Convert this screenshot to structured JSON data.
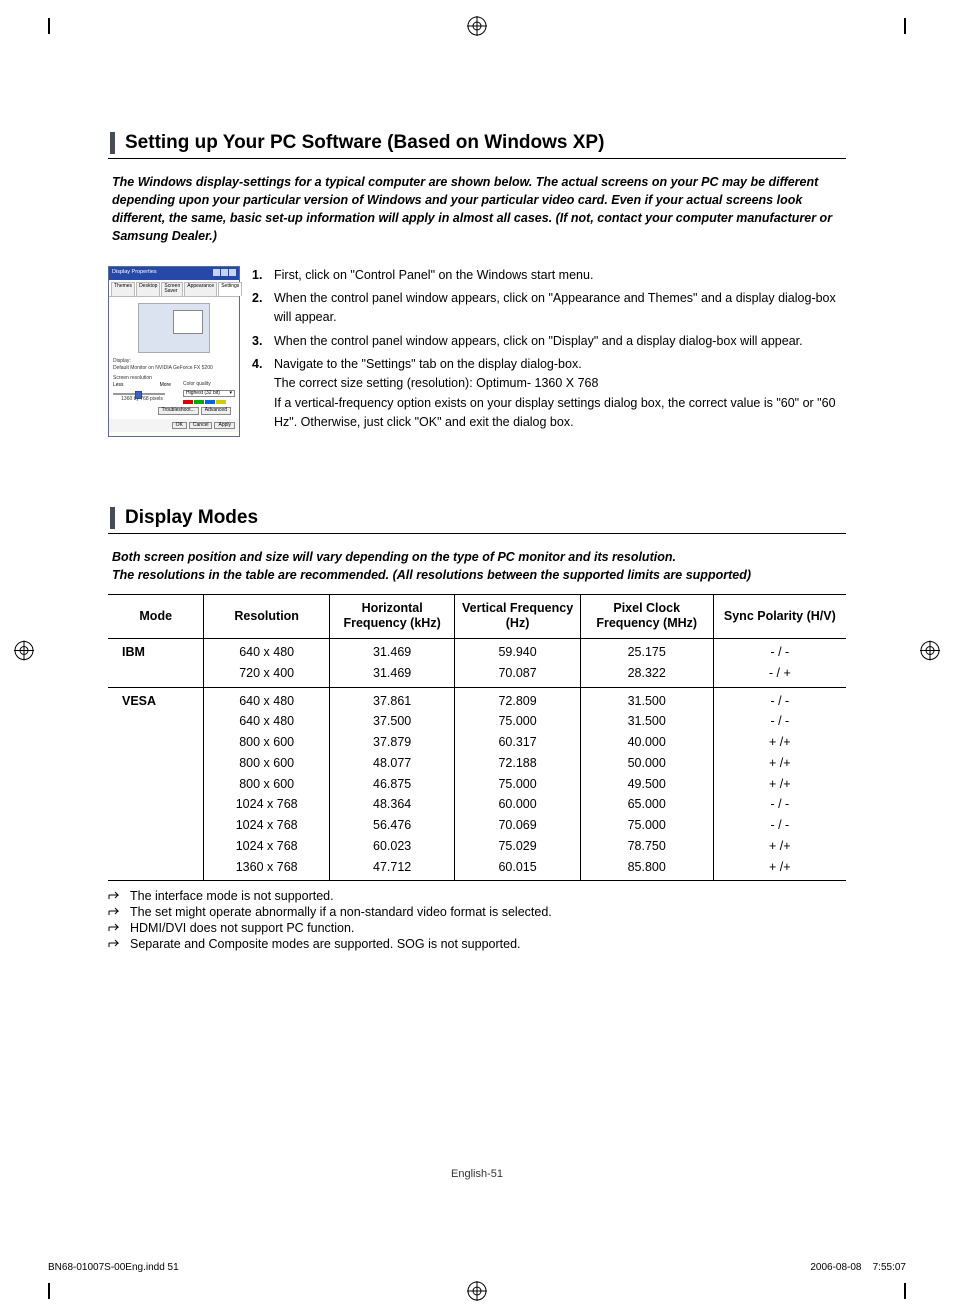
{
  "section1_title": "Setting up Your PC Software (Based on Windows XP)",
  "section1_intro": "The Windows display-settings for a typical computer are shown below. The actual screens on your PC may be different depending upon your particular version of Windows and your particular video card. Even if your actual screens look different, the same, basic set-up information will apply in almost all cases. (If not, contact your computer manufacturer or Samsung Dealer.)",
  "dialog": {
    "title": "Display Properties",
    "tabs": [
      "Themes",
      "Desktop",
      "Screen Saver",
      "Appearance",
      "Settings"
    ],
    "display_label": "Display:",
    "display_value": "Default Monitor on NVIDIA GeForce FX 5200",
    "resolution_label": "Screen resolution",
    "res_less": "Less",
    "res_more": "More",
    "res_value": "1360 by 768 pixels",
    "quality_label": "Color quality",
    "quality_value": "Highest (32 bit)",
    "troubleshoot": "Troubleshoot...",
    "advanced": "Advanced",
    "ok": "OK",
    "cancel": "Cancel",
    "apply": "Apply"
  },
  "steps": {
    "s1": "First, click on \"Control Panel\" on the Windows start menu.",
    "s2": "When the control panel window appears, click on \"Appearance and Themes\" and a display dialog-box will appear.",
    "s3": "When the control panel window appears, click on \"Display\" and a display dialog-box will appear.",
    "s4_a": "Navigate to the \"Settings\" tab on the display dialog-box.",
    "s4_b": "The correct size setting (resolution): Optimum- 1360 X 768",
    "s4_c": "If a vertical-frequency option exists on your display settings dialog box, the correct value is \"60\" or \"60 Hz\". Otherwise, just click \"OK\" and exit the dialog box."
  },
  "section2_title": "Display Modes",
  "section2_intro_a": "Both screen position and size will vary depending on the type of PC monitor and its resolution.",
  "section2_intro_b": "The resolutions in the table are recommended. (All resolutions between the supported limits are supported)",
  "table": {
    "headers": [
      "Mode",
      "Resolution",
      "Horizontal Frequency (kHz)",
      "Vertical Frequency (Hz)",
      "Pixel Clock Frequency (MHz)",
      "Sync Polarity (H/V)"
    ],
    "rows": [
      {
        "mode": "IBM",
        "res": "640 x 480",
        "hf": "31.469",
        "vf": "59.940",
        "pc": "25.175",
        "sp": "- / -",
        "first": true
      },
      {
        "mode": "",
        "res": "720 x 400",
        "hf": "31.469",
        "vf": "70.087",
        "pc": "28.322",
        "sp": "- / +",
        "last": true
      },
      {
        "mode": "VESA",
        "res": "640 x 480",
        "hf": "37.861",
        "vf": "72.809",
        "pc": "31.500",
        "sp": "- / -",
        "first": true
      },
      {
        "mode": "",
        "res": "640 x 480",
        "hf": "37.500",
        "vf": "75.000",
        "pc": "31.500",
        "sp": "- / -"
      },
      {
        "mode": "",
        "res": "800 x 600",
        "hf": "37.879",
        "vf": "60.317",
        "pc": "40.000",
        "sp": "+ /+"
      },
      {
        "mode": "",
        "res": "800 x 600",
        "hf": "48.077",
        "vf": "72.188",
        "pc": "50.000",
        "sp": "+ /+"
      },
      {
        "mode": "",
        "res": "800 x 600",
        "hf": "46.875",
        "vf": "75.000",
        "pc": "49.500",
        "sp": "+ /+"
      },
      {
        "mode": "",
        "res": "1024 x 768",
        "hf": "48.364",
        "vf": "60.000",
        "pc": "65.000",
        "sp": "- / -"
      },
      {
        "mode": "",
        "res": "1024 x 768",
        "hf": "56.476",
        "vf": "70.069",
        "pc": "75.000",
        "sp": "- / -"
      },
      {
        "mode": "",
        "res": "1024 x 768",
        "hf": "60.023",
        "vf": "75.029",
        "pc": "78.750",
        "sp": "+ /+"
      },
      {
        "mode": "",
        "res": "1360 x 768",
        "hf": "47.712",
        "vf": "60.015",
        "pc": "85.800",
        "sp": "+ /+",
        "last": true
      }
    ]
  },
  "notes": [
    "The interface mode is not supported.",
    "The set might operate abnormally if a non-standard video format is selected.",
    "HDMI/DVI does not support PC function.",
    "Separate and Composite modes are supported. SOG is not supported."
  ],
  "page_number": "English-51",
  "footer_left": "BN68-01007S-00Eng.indd   51",
  "footer_right_date": "2006-08-08",
  "footer_right_time": "7:55:07"
}
